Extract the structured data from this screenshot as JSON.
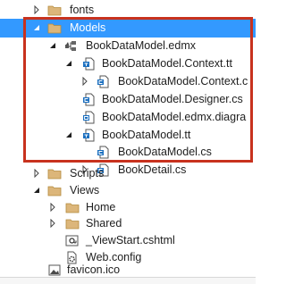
{
  "solution_explorer": {
    "items": [
      {
        "label": "fonts",
        "icon": "folder-icon",
        "expander": "collapsed"
      },
      {
        "label": "Models",
        "icon": "folder-icon",
        "expander": "expanded",
        "selected": true
      },
      {
        "label": "BookDataModel.edmx",
        "icon": "edmx-model-icon",
        "expander": "expanded"
      },
      {
        "label": "BookDataModel.Context.tt",
        "icon": "template-file-icon",
        "expander": "expanded"
      },
      {
        "label": "BookDataModel.Context.c",
        "icon": "csharp-file-icon",
        "expander": "collapsed"
      },
      {
        "label": "BookDataModel.Designer.cs",
        "icon": "csharp-file-icon",
        "expander": "none"
      },
      {
        "label": "BookDataModel.edmx.diagra",
        "icon": "diagram-file-icon",
        "expander": "none"
      },
      {
        "label": "BookDataModel.tt",
        "icon": "template-file-icon",
        "expander": "expanded"
      },
      {
        "label": "BookDataModel.cs",
        "icon": "csharp-file-icon",
        "expander": "none"
      },
      {
        "label": "BookDetail.cs",
        "icon": "csharp-file-icon",
        "expander": "collapsed"
      },
      {
        "label": "Scripts",
        "icon": "folder-icon",
        "expander": "collapsed"
      },
      {
        "label": "Views",
        "icon": "folder-icon",
        "expander": "expanded"
      },
      {
        "label": "Home",
        "icon": "folder-icon",
        "expander": "collapsed"
      },
      {
        "label": "Shared",
        "icon": "folder-icon",
        "expander": "collapsed"
      },
      {
        "label": "_ViewStart.cshtml",
        "icon": "razor-file-icon",
        "expander": "none"
      },
      {
        "label": "Web.config",
        "icon": "config-file-icon",
        "expander": "none"
      },
      {
        "label": "favicon.ico",
        "icon": "image-file-icon",
        "expander": "none"
      }
    ]
  },
  "colors": {
    "selection": "#3399ff",
    "highlight_border": "#c8321e",
    "folder": "#dcb67a"
  }
}
